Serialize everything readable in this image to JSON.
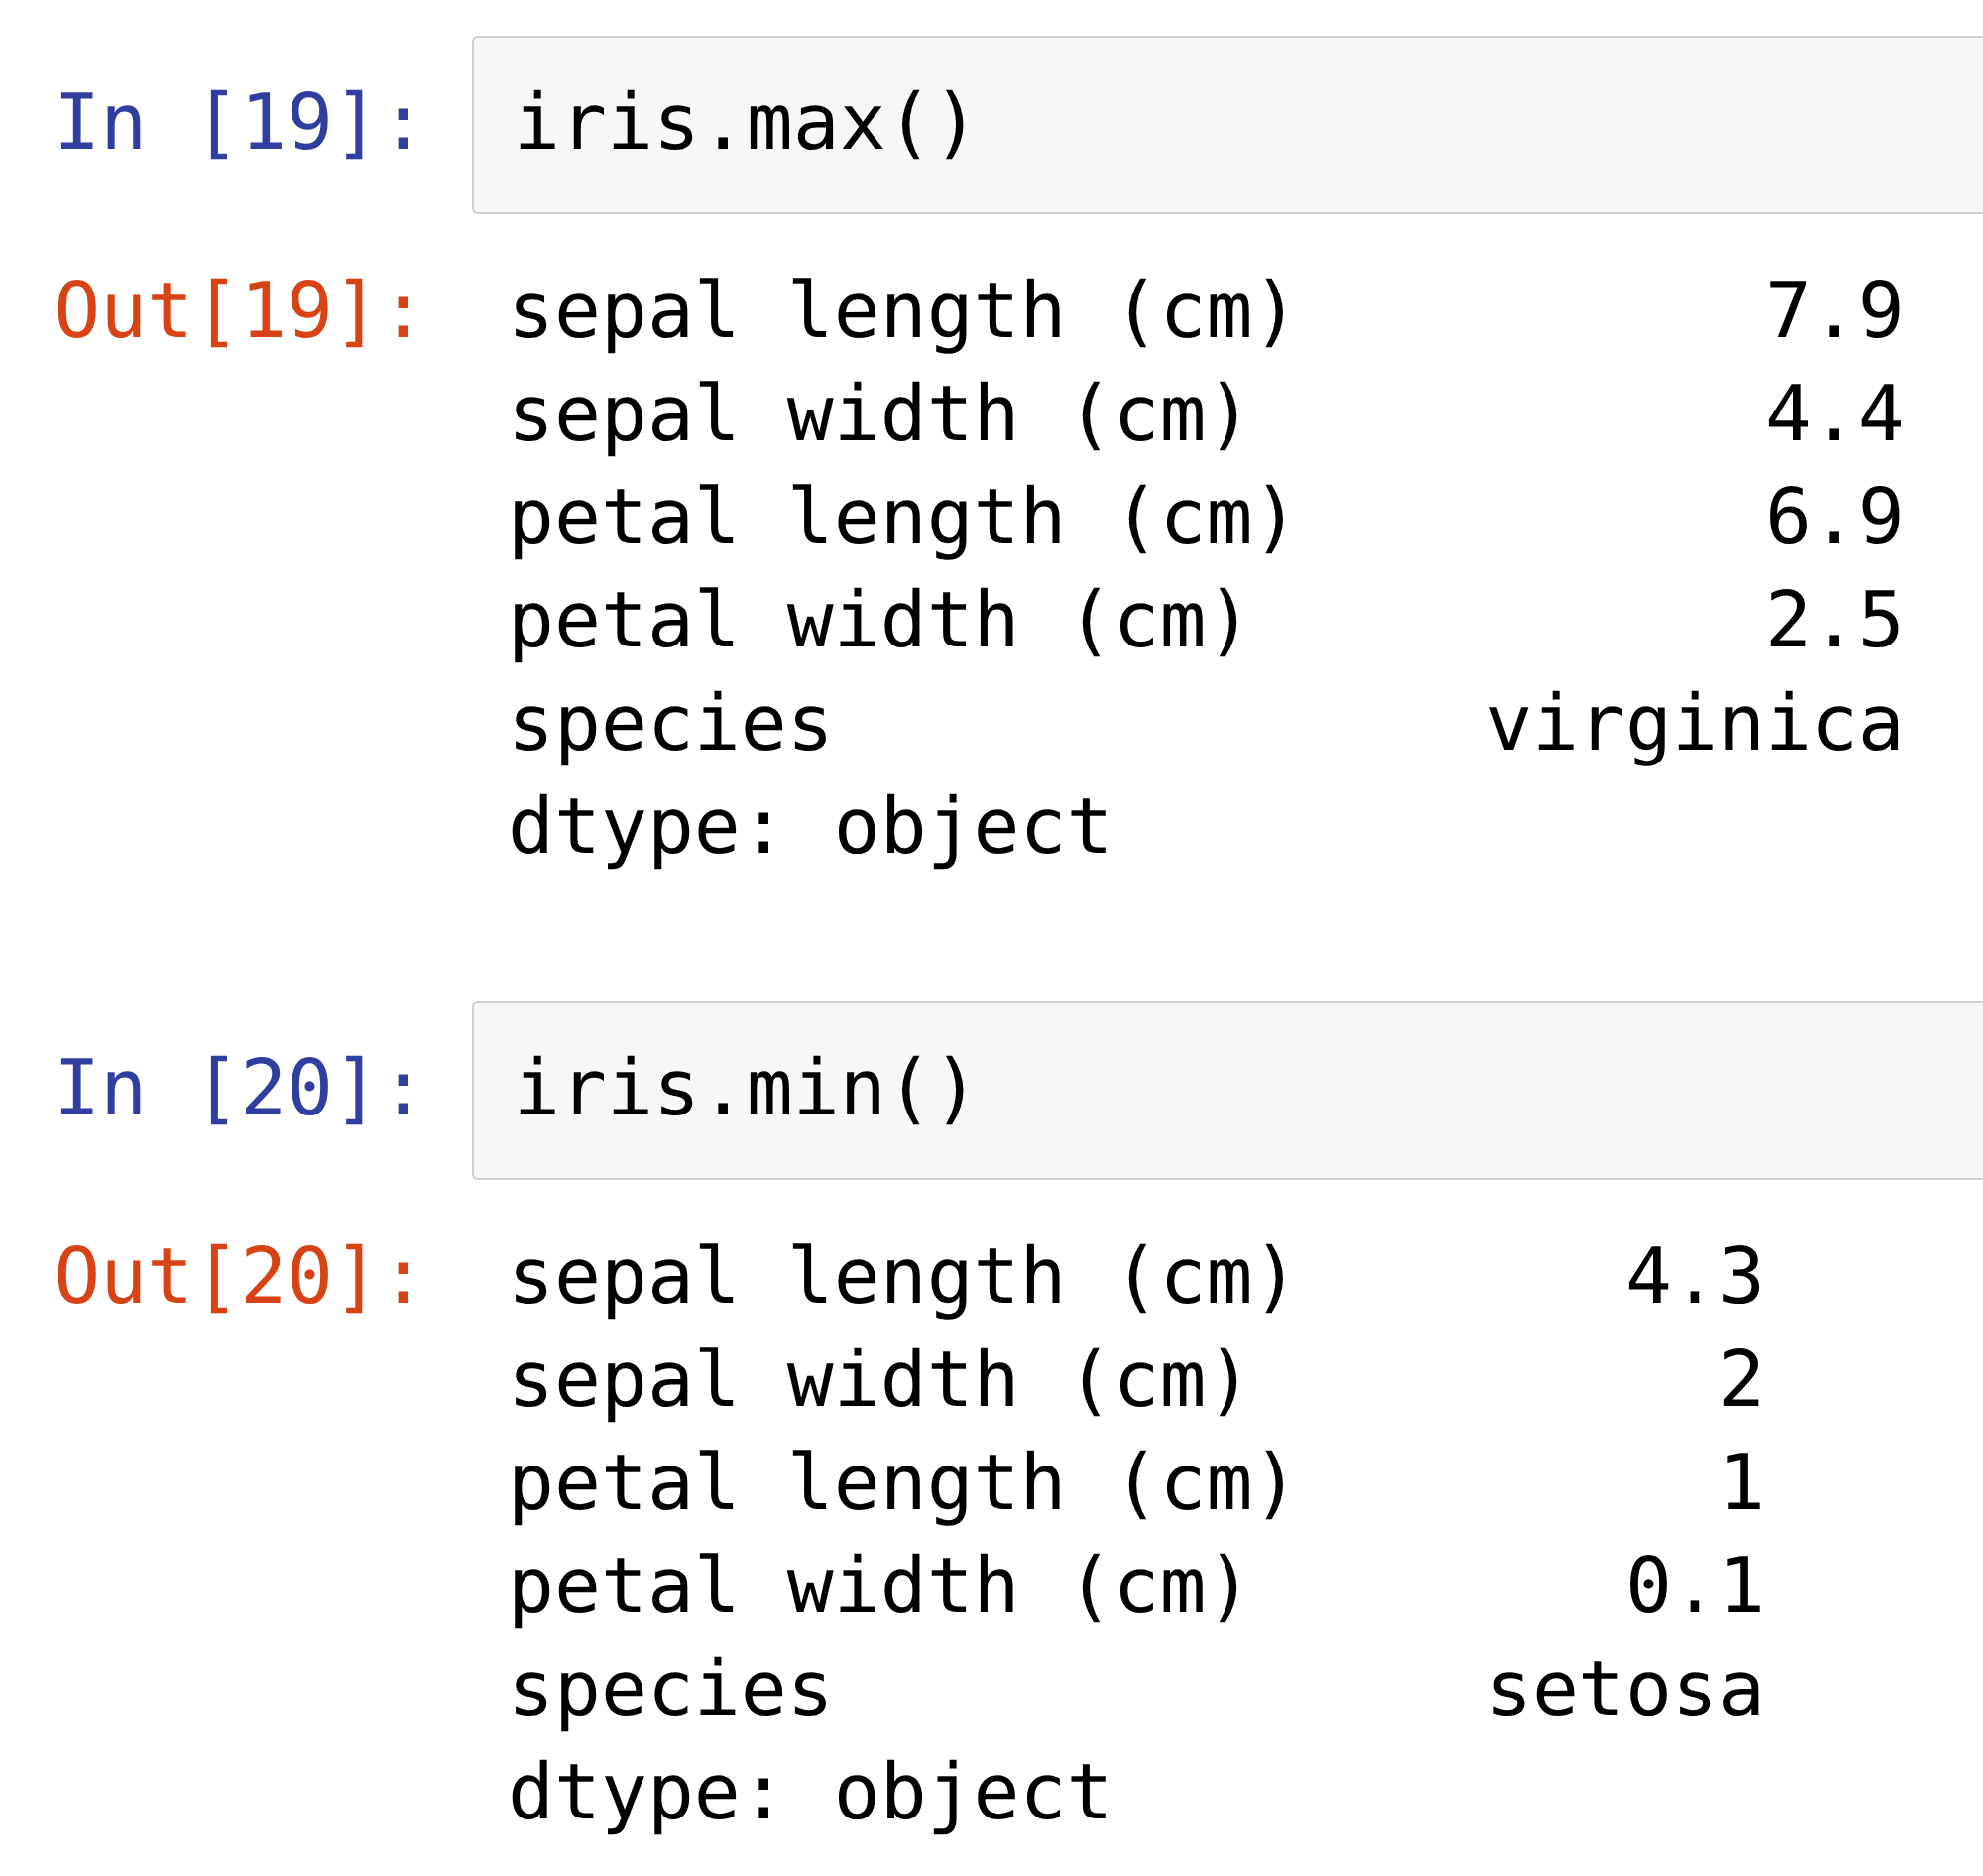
{
  "cells": [
    {
      "input_prompt": "In [19]:",
      "code": "iris.max()",
      "output_prompt": "Out[19]:",
      "output": {
        "rows": [
          {
            "name": "sepal length (cm)",
            "value": "7.9"
          },
          {
            "name": "sepal width (cm)",
            "value": "4.4"
          },
          {
            "name": "petal length (cm)",
            "value": "6.9"
          },
          {
            "name": "petal width (cm)",
            "value": "2.5"
          },
          {
            "name": "species",
            "value": "virginica"
          }
        ],
        "footer": "dtype: object"
      }
    },
    {
      "input_prompt": "In [20]:",
      "code": "iris.min()",
      "output_prompt": "Out[20]:",
      "output": {
        "rows": [
          {
            "name": "sepal length (cm)",
            "value": "4.3"
          },
          {
            "name": "sepal width (cm)",
            "value": "2"
          },
          {
            "name": "petal length (cm)",
            "value": "1"
          },
          {
            "name": "petal width (cm)",
            "value": "0.1"
          },
          {
            "name": "species",
            "value": "setosa"
          }
        ],
        "footer": "dtype: object"
      }
    }
  ]
}
